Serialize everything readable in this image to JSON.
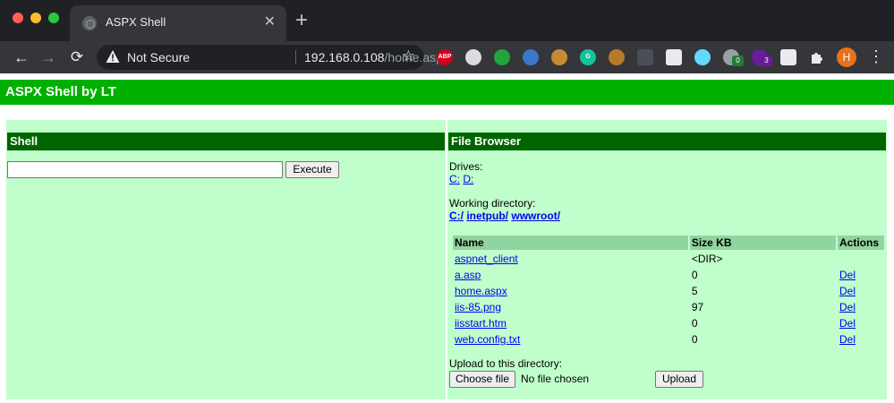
{
  "browser": {
    "tab_title": "ASPX Shell",
    "tab_close": "✕",
    "new_tab": "+",
    "security_label": "Not Secure",
    "url_host": "192.168.0.108",
    "url_path": "/home.aspx",
    "profile_initial": "H",
    "extensions": [
      {
        "name": "adblock-plus-icon",
        "label": "ABP",
        "color": "#d0021b"
      },
      {
        "name": "extension-cloud-icon",
        "label": "",
        "color": "#dadce0"
      },
      {
        "name": "vpn-shield-icon",
        "label": "",
        "color": "#22a33c"
      },
      {
        "name": "extension-box-icon",
        "label": "",
        "color": "#3a78c9"
      },
      {
        "name": "cookie-icon",
        "label": "",
        "color": "#c98a34"
      },
      {
        "name": "grammarly-icon",
        "label": "G",
        "color": "#15c39a"
      },
      {
        "name": "cookie-editor-icon",
        "label": "",
        "color": "#b77b2a"
      },
      {
        "name": "dots-extension-icon",
        "label": "",
        "color": "#4a4f57"
      },
      {
        "name": "dev-extension-icon",
        "label": "",
        "color": "#e8eaed"
      },
      {
        "name": "react-icon",
        "label": "",
        "color": "#61dafb"
      },
      {
        "name": "wappalyzer-icon",
        "label": "",
        "color": "#9aa0a6"
      },
      {
        "name": "purple-extension-icon",
        "label": "",
        "color": "#6a1b9a"
      },
      {
        "name": "mail-extension-icon",
        "label": "",
        "color": "#e8eaed"
      }
    ],
    "badges": {
      "wappalyzer": "0",
      "purple": "3"
    }
  },
  "page": {
    "header_title": "ASPX Shell by LT",
    "shell": {
      "heading": "Shell",
      "command_value": "",
      "execute_label": "Execute"
    },
    "file_browser": {
      "heading": "File Browser",
      "drives_label": "Drives:",
      "drives": [
        "C:",
        "D:"
      ],
      "working_dir_label": "Working directory:",
      "path_parts": [
        "C:/",
        "inetpub/",
        "wwwroot/"
      ],
      "columns": [
        "Name",
        "Size KB",
        "Actions"
      ],
      "files": [
        {
          "name": "aspnet_client",
          "size": "<DIR>",
          "action": ""
        },
        {
          "name": "a.asp",
          "size": "0",
          "action": "Del"
        },
        {
          "name": "home.aspx",
          "size": "5",
          "action": "Del"
        },
        {
          "name": "iis-85.png",
          "size": "97",
          "action": "Del"
        },
        {
          "name": "iisstart.htm",
          "size": "0",
          "action": "Del"
        },
        {
          "name": "web.config.txt",
          "size": "0",
          "action": "Del"
        }
      ],
      "upload_label": "Upload to this directory:",
      "choose_file_label": "Choose file",
      "no_file_label": "No file chosen",
      "upload_button_label": "Upload"
    }
  }
}
